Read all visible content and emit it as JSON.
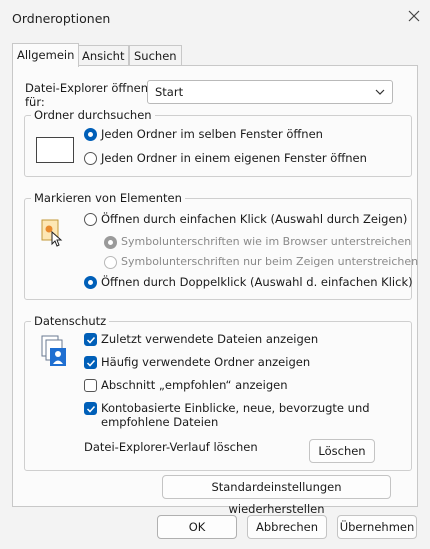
{
  "window": {
    "title": "Ordneroptionen",
    "close_icon": "close-icon"
  },
  "tabs": [
    {
      "label": "Allgemein",
      "active": true
    },
    {
      "label": "Ansicht",
      "active": false
    },
    {
      "label": "Suchen",
      "active": false
    }
  ],
  "explorer_open": {
    "label_line1": "Datei-Explorer öffnen",
    "label_line2": "für:",
    "value": "Start"
  },
  "browse": {
    "title": "Ordner durchsuchen",
    "options": [
      {
        "label": "Jeden Ordner im selben Fenster öffnen",
        "selected": true
      },
      {
        "label": "Jeden Ordner in einem eigenen Fenster öffnen",
        "selected": false
      }
    ]
  },
  "click_items": {
    "title": "Markieren von Elementen",
    "single_click": {
      "label": "Öffnen durch einfachen Klick (Auswahl durch Zeigen)",
      "selected": false
    },
    "sub_options": [
      {
        "label": "Symbolunterschriften wie im Browser unterstreichen",
        "selected": true,
        "disabled": true
      },
      {
        "label": "Symbolunterschriften nur beim Zeigen unterstreichen",
        "selected": false,
        "disabled": true
      }
    ],
    "double_click": {
      "label": "Öffnen durch Doppelklick (Auswahl d. einfachen Klick)",
      "selected": true
    }
  },
  "privacy": {
    "title": "Datenschutz",
    "checks": [
      {
        "label": "Zuletzt verwendete Dateien anzeigen",
        "checked": true
      },
      {
        "label": "Häufig verwendete Ordner anzeigen",
        "checked": true
      },
      {
        "label": "Abschnitt „empfohlen“ anzeigen",
        "checked": false
      },
      {
        "label_line1": "Kontobasierte Einblicke, neue, bevorzugte und",
        "label_line2": "empfohlene Dateien",
        "checked": true
      }
    ],
    "clear_label": "Datei-Explorer-Verlauf löschen",
    "clear_button": "Löschen"
  },
  "restore_button": "Standardeinstellungen wiederherstellen",
  "footer": {
    "ok": "OK",
    "cancel": "Abbrechen",
    "apply": "Übernehmen"
  },
  "colors": {
    "accent": "#005fb8"
  }
}
